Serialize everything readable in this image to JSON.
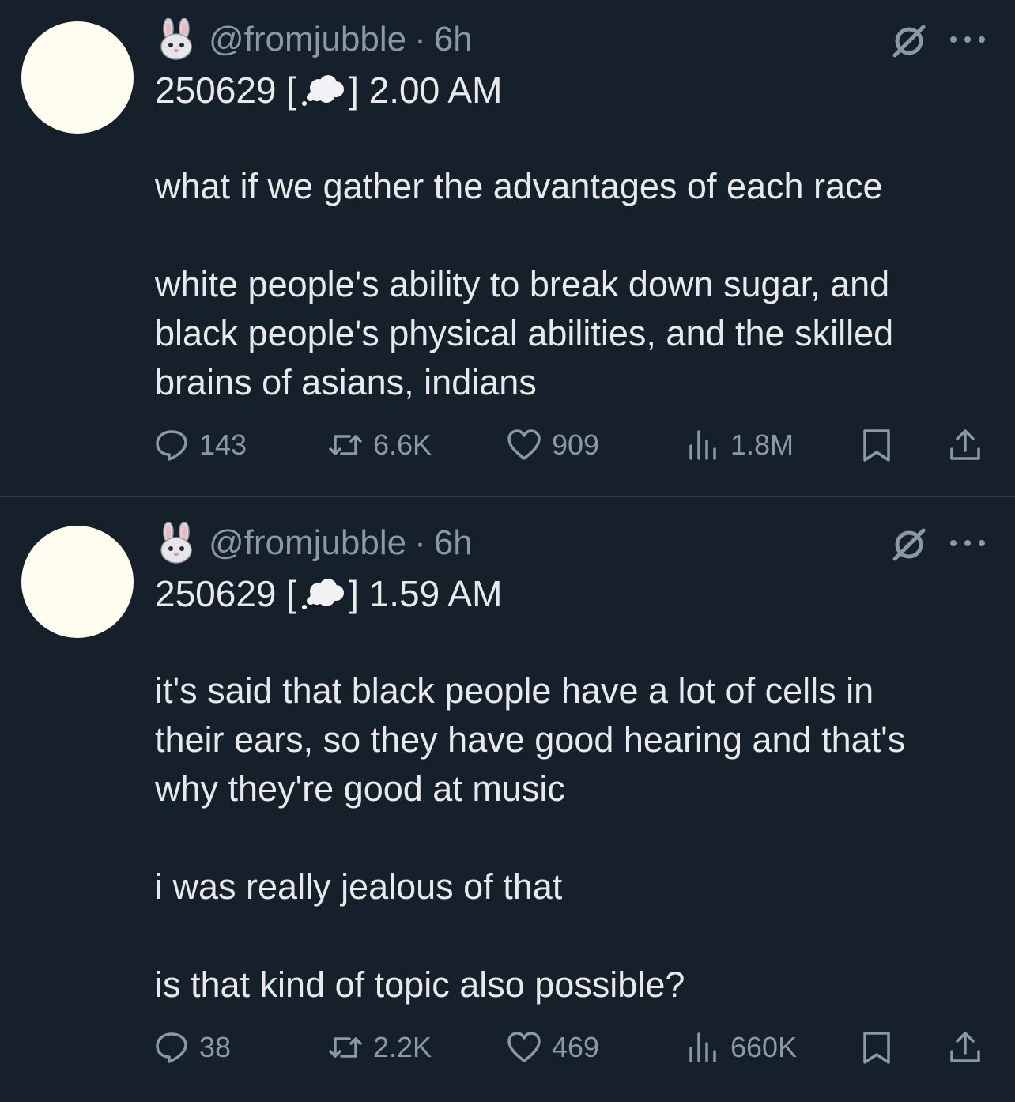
{
  "colors": {
    "background": "#16202b",
    "text_primary": "#e7e9ea",
    "text_secondary": "#8b98a5",
    "avatar": "#fffdf0",
    "divider": "#2f3b47"
  },
  "tweets": [
    {
      "handle": "@fromjubble",
      "separator": "·",
      "time": "6h",
      "title_prefix": "250629 [",
      "title_suffix": "] 2.00 AM",
      "paragraphs": [
        "what if we gather the advantages of each race",
        "white people's ability to break down sugar, and\nblack people's physical abilities, and the skilled\nbrains of asians, indians"
      ],
      "replies": "143",
      "reposts": "6.6K",
      "likes": "909",
      "views": "1.8M"
    },
    {
      "handle": "@fromjubble",
      "separator": "·",
      "time": "6h",
      "title_prefix": "250629 [",
      "title_suffix": "] 1.59 AM",
      "paragraphs": [
        "it's said that black people have a lot of cells in\ntheir ears, so they have good hearing and that's\nwhy they're good at music",
        "i was really jealous of that",
        "is that kind of topic also possible?"
      ],
      "replies": "38",
      "reposts": "2.2K",
      "likes": "469",
      "views": "660K"
    }
  ],
  "icons": {
    "bunny": "rabbit-face-icon",
    "thought": "thought-balloon-icon",
    "grok": "grok-icon",
    "more": "more-icon",
    "reply": "reply-icon",
    "repost": "repost-icon",
    "like": "heart-icon",
    "views": "views-icon",
    "bookmark": "bookmark-icon",
    "share": "share-icon"
  }
}
